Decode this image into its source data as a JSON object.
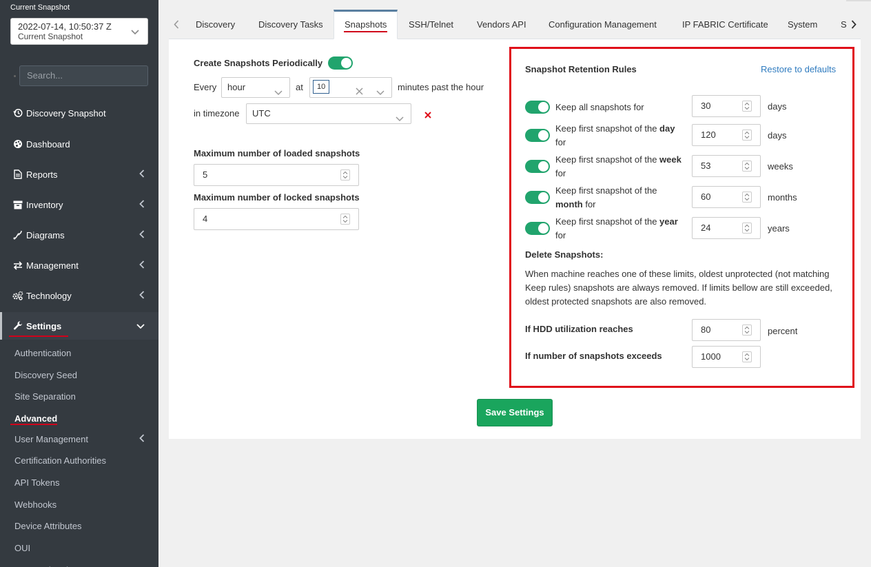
{
  "sidebar": {
    "snapshot_label": "Current Snapshot",
    "snapshot_value": "2022-07-14, 10:50:37 Z",
    "snapshot_sub": "Current Snapshot",
    "search_placeholder": "Search...",
    "items": [
      {
        "label": "Discovery Snapshot",
        "icon": "history-icon"
      },
      {
        "label": "Dashboard",
        "icon": "palette-icon"
      },
      {
        "label": "Reports",
        "icon": "file-icon"
      },
      {
        "label": "Inventory",
        "icon": "archive-icon"
      },
      {
        "label": "Diagrams",
        "icon": "diagram-icon"
      },
      {
        "label": "Management",
        "icon": "exchange-icon"
      },
      {
        "label": "Technology",
        "icon": "cogs-icon"
      },
      {
        "label": "Settings",
        "icon": "wrench-icon"
      }
    ],
    "subitems": [
      "Authentication",
      "Discovery Seed",
      "Site Separation",
      "Advanced",
      "User Management",
      "Certification Authorities",
      "API Tokens",
      "Webhooks",
      "Device Attributes",
      "OUI",
      "Setup Wizard"
    ]
  },
  "tabs": [
    "Discovery",
    "Discovery Tasks",
    "Snapshots",
    "SSH/Telnet",
    "Vendors API",
    "Configuration Management",
    "IP FABRIC Certificate",
    "System",
    "S"
  ],
  "periodic": {
    "label": "Create Snapshots Periodically",
    "every_label": "Every",
    "every_value": "hour",
    "at_label": "at",
    "at_value": "10",
    "minutes_label": "minutes past the hour",
    "tz_label": "in timezone",
    "tz_value": "UTC"
  },
  "limits": {
    "loaded_label": "Maximum number of loaded snapshots",
    "loaded_value": "5",
    "locked_label": "Maximum number of locked snapshots",
    "locked_value": "4"
  },
  "retention": {
    "title": "Snapshot Retention Rules",
    "restore": "Restore to defaults",
    "rules": [
      {
        "pre": "Keep all snapshots for",
        "bold": "",
        "post": "",
        "value": "30",
        "unit": "days"
      },
      {
        "pre": "Keep first snapshot of the ",
        "bold": "day",
        "post": " for",
        "value": "120",
        "unit": "days"
      },
      {
        "pre": "Keep first snapshot of the ",
        "bold": "week",
        "post": " for",
        "value": "53",
        "unit": "weeks"
      },
      {
        "pre": "Keep first snapshot of the ",
        "bold": "month",
        "post": " for",
        "value": "60",
        "unit": "months"
      },
      {
        "pre": "Keep first snapshot of the ",
        "bold": "year",
        "post": " for",
        "value": "24",
        "unit": "years"
      }
    ],
    "delete_title": "Delete Snapshots:",
    "delete_desc": "When machine reaches one of these limits, oldest unprotected (not matching Keep rules) snapshots are always removed. If limits bellow are still exceeded, oldest protected snapshots are also removed.",
    "hdd_label": "If HDD utilization reaches",
    "hdd_value": "80",
    "hdd_unit": "percent",
    "count_label": "If number of snapshots exceeds",
    "count_value": "1000"
  },
  "save_label": "Save Settings",
  "colors": {
    "accent": "#21a46d",
    "highlight": "#e0101a",
    "link": "#2f7bbf"
  }
}
